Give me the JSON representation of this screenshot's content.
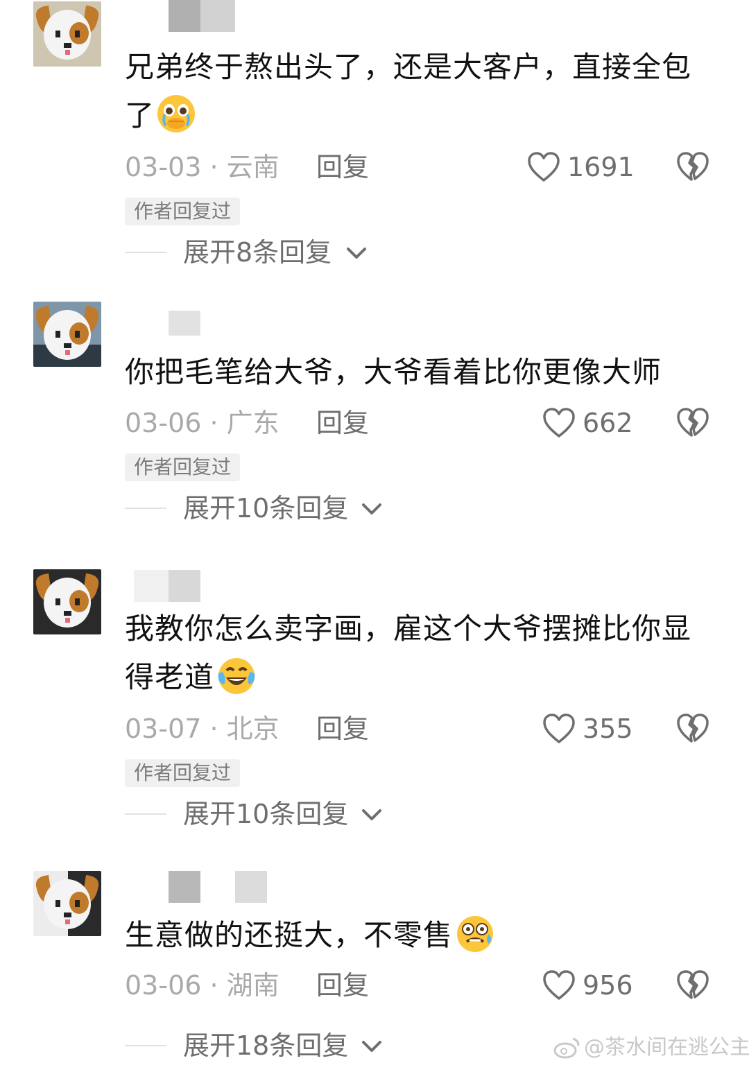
{
  "comments": [
    {
      "text": "兄弟终于熬出头了，还是大客户，直接全包了",
      "emoji": "crying-pleading-emoji",
      "date": "03-03 · 云南",
      "reply": "回复",
      "likes": "1691",
      "badge": "作者回复过",
      "expand": "展开8条回复"
    },
    {
      "text": "你把毛笔给大爷，大爷看着比你更像大师",
      "emoji": "",
      "date": "03-06 · 广东",
      "reply": "回复",
      "likes": "662",
      "badge": "作者回复过",
      "expand": "展开10条回复"
    },
    {
      "text": "我教你怎么卖字画，雇这个大爷摆摊比你显得老道",
      "emoji": "laughing-crying-emoji",
      "date": "03-07 · 北京",
      "reply": "回复",
      "likes": "355",
      "badge": "作者回复过",
      "expand": "展开10条回复"
    },
    {
      "text": "生意做的还挺大，不零售",
      "emoji": "woozy-sweat-emoji",
      "date": "03-06 · 湖南",
      "reply": "回复",
      "likes": "956",
      "badge": "",
      "expand": "展开18条回复"
    }
  ],
  "watermark": "@茶水间在逃公主",
  "colors": {
    "text": "#111111",
    "meta_gray": "#a9a9a9",
    "action_gray": "#6e6e6e",
    "badge_bg": "#f0f0f0"
  }
}
